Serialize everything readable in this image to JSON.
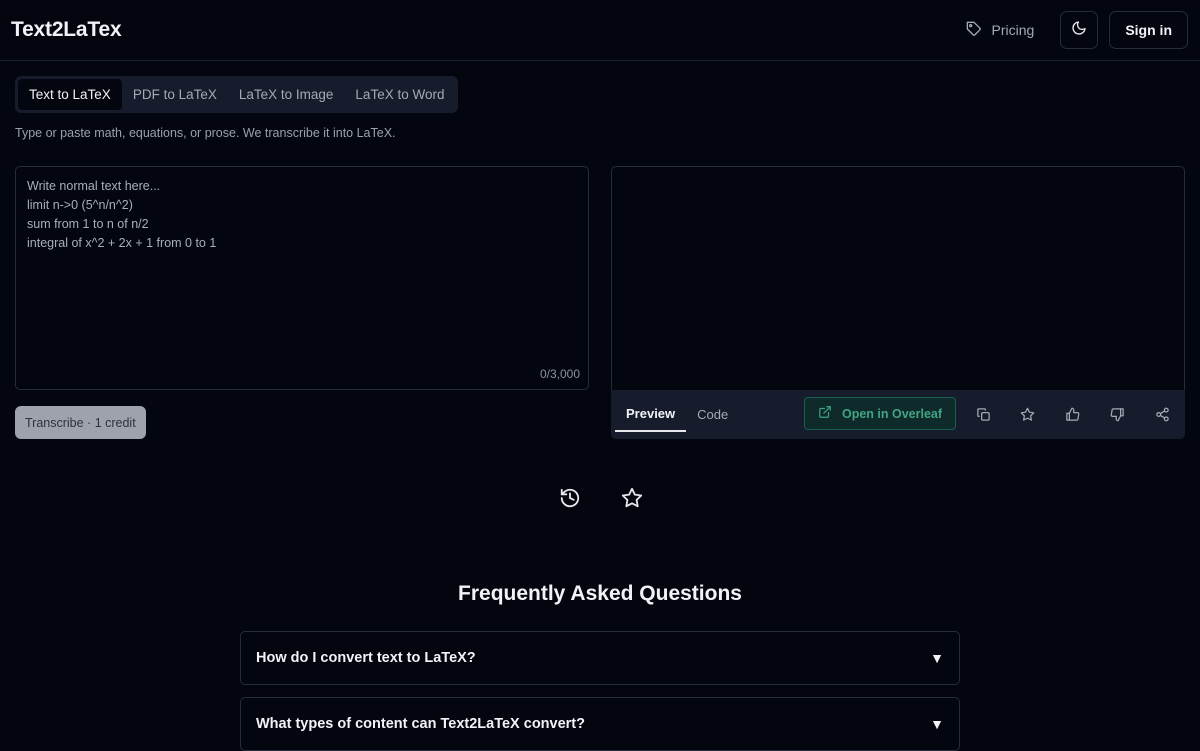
{
  "header": {
    "logo": "Text2LaTex",
    "pricing_label": "Pricing",
    "theme_icon": "moon-icon",
    "signin_label": "Sign in"
  },
  "tabs": [
    {
      "label": "Text to LaTeX",
      "active": true
    },
    {
      "label": "PDF to LaTeX"
    },
    {
      "label": "LaTeX to Image"
    },
    {
      "label": "LaTeX to Word"
    }
  ],
  "subtitle": "Type or paste math, equations, or prose. We transcribe it into LaTeX.",
  "input": {
    "placeholder": "Write normal text here...\nlimit n->0 (5^n/n^2)\nsum from 1 to n of n/2\nintegral of x^2 + 2x + 1 from 0 to 1",
    "value": "",
    "counter": "0/3,000"
  },
  "transcribe_label": "Transcribe · 1 credit",
  "output": {
    "tabs": [
      {
        "label": "Preview",
        "active": true
      },
      {
        "label": "Code"
      }
    ],
    "overleaf_label": "Open in Overleaf",
    "tool_icons": [
      "copy-icon",
      "star-icon",
      "thumbs-up-icon",
      "thumbs-down-icon",
      "share-icon"
    ]
  },
  "center_icons": [
    "history-icon",
    "star-icon"
  ],
  "faq": {
    "title": "Frequently Asked Questions",
    "items": [
      {
        "question": "How do I convert text to LaTeX?",
        "arrow": "▼"
      },
      {
        "question": "What types of content can Text2LaTeX convert?",
        "arrow": "▼"
      }
    ]
  },
  "colors": {
    "background": "#03060f",
    "panel": "#161c2b",
    "border": "#262c3a",
    "overleaf_green": "#41a584"
  }
}
